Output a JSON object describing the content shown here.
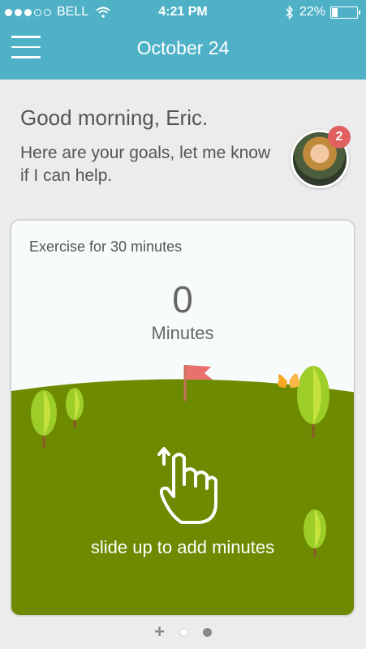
{
  "status_bar": {
    "carrier": "BELL",
    "time": "4:21 PM",
    "battery_text": "22%",
    "battery_level": 0.22,
    "signal_bars_filled": 3,
    "signal_bars_total": 5
  },
  "header": {
    "title": "October 24",
    "menu_icon": "hamburger-icon",
    "color": "#4fb1c6"
  },
  "greeting": {
    "title": "Good morning, Eric.",
    "subtitle": "Here are your goals, let me know if I can help.",
    "notification_count": "2"
  },
  "goal_card": {
    "title": "Exercise for 30 minutes",
    "value": "0",
    "unit": "Minutes",
    "hint": "slide up to add minutes",
    "ground_color": "#6d8a00",
    "flag_color": "#e8706d"
  },
  "pager": {
    "add_label": "+",
    "pages": 2,
    "active_index": 0
  }
}
